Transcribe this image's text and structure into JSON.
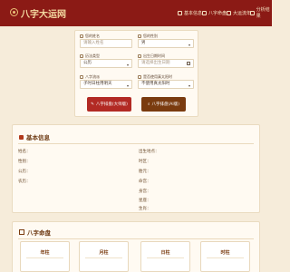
{
  "header": {
    "logo_text": "八字大运网",
    "nav": [
      {
        "label": "基本信息",
        "icon": "user-icon"
      },
      {
        "label": "八字命盘",
        "icon": "grid-icon"
      },
      {
        "label": "大运流年",
        "icon": "chart-icon"
      },
      {
        "label": "分析结果",
        "icon": "list-icon"
      }
    ]
  },
  "form": {
    "name_label": "您的姓名",
    "name_placeholder": "请输入姓名",
    "gender_label": "您的性别",
    "gender_value": "男",
    "calendar_label": "历法类型",
    "calendar_value": "公历",
    "birth_label": "出生日期时间",
    "birth_placeholder": "请选择出生日期",
    "school_label": "八字流派",
    "school_value": "子时日柱用明天",
    "sect_label": "是否使用真太阳时",
    "sect_value": "不使用真太阳时"
  },
  "buttons": {
    "calc_label": "八字排盘(大师版)",
    "ai_label": "八字排盘(AI版)"
  },
  "basic_info": {
    "title": "基本信息",
    "left": [
      "姓名：",
      "性别：",
      "公历：",
      "农历："
    ],
    "right": [
      "出生地点：",
      "时区：",
      "胎元：",
      "命宫：",
      "身宫：",
      "星座：",
      "生肖："
    ]
  },
  "bazi": {
    "title": "八字命盘",
    "pillars": [
      "年柱",
      "月柱",
      "日柱",
      "时柱"
    ]
  },
  "colors": {
    "header_bg": "#8b1a15",
    "accent_red": "#b22a24",
    "accent_brown": "#7a3b0f",
    "page_bg": "#f6ecda"
  }
}
